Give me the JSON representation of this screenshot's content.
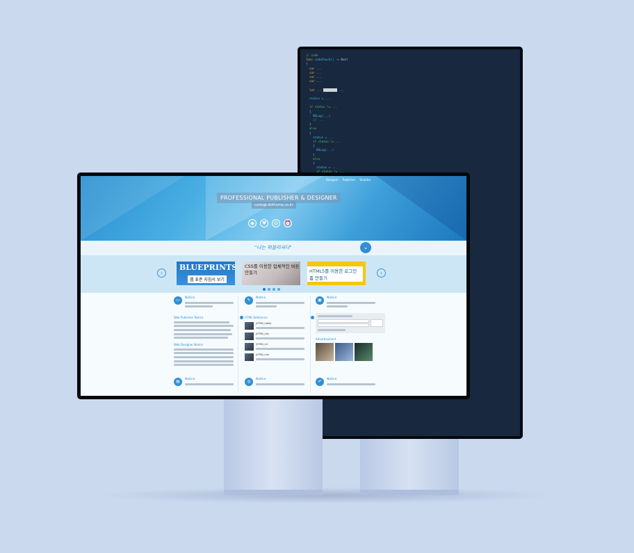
{
  "hero": {
    "nav": [
      "Designer",
      "Publisher",
      "Youtube"
    ],
    "title": "PROFESSIONAL PUBLISHER & DESIGNER",
    "url": "conkqk.dothome.co.kr"
  },
  "tagline": "\"나는 퍼블리셔다\"",
  "carousel": {
    "slide1_title": "BLUEPRINTS",
    "slide1_caption": "웹 표준 지침서 보기",
    "slide2_caption": "CSS를 이용한 입체적인 버튼 만들기",
    "slide3_caption": "HTML5를 이용한 로그인 폼 만들기"
  },
  "content": {
    "notice_label": "Notice",
    "web_publisher_notice": "Web Publisher Notice",
    "web_designer_notice": "Web Designer Notice",
    "html_reference": "HTML Reference",
    "ref_items": [
      "[HTML] table",
      "[HTML] div",
      "[HTML] dl",
      "[HTML] em"
    ],
    "advertisement": "Advertisement"
  },
  "colors": {
    "accent": "#2f8fd4",
    "background": "#cbd9ef",
    "code_bg": "#17283f"
  }
}
